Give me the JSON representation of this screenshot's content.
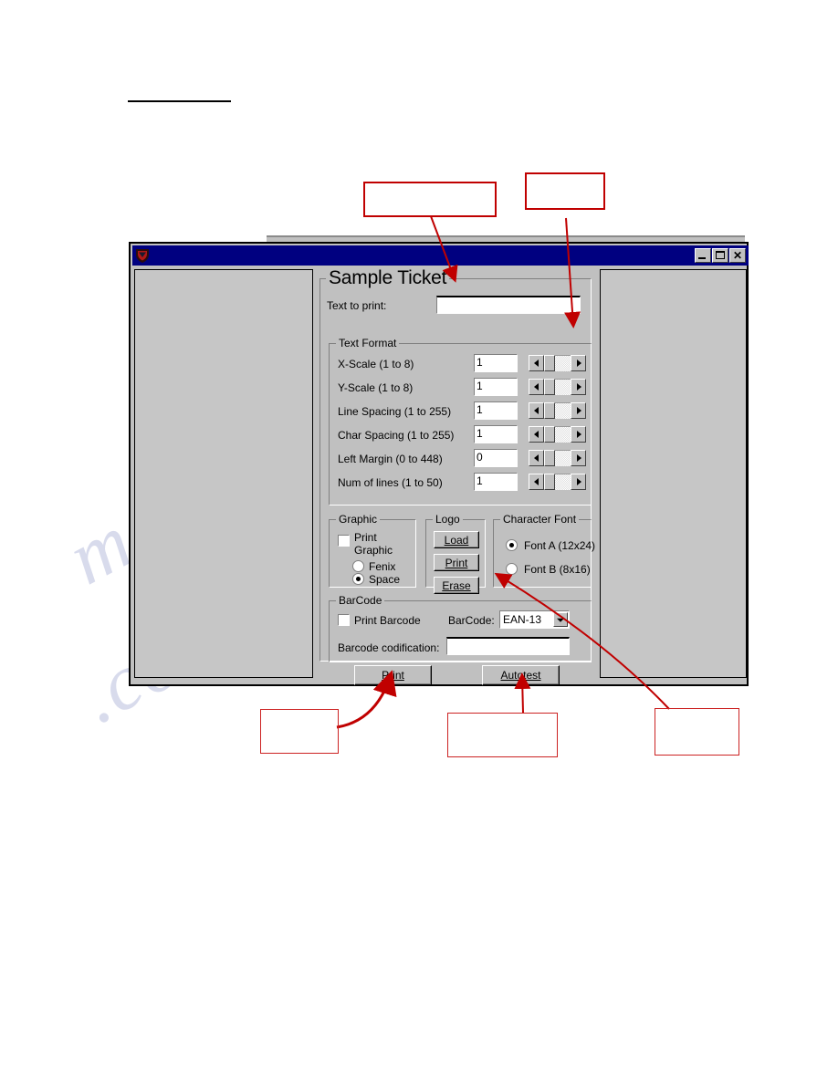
{
  "page": {
    "heading_rule": "",
    "watermark_line1": "manualslib",
    "watermark_line2": ".com"
  },
  "window": {
    "title": "",
    "icon": "app-shield-icon",
    "controls": {
      "minimize": "minimize-icon",
      "maximize": "maximize-icon",
      "close": "✕"
    }
  },
  "dialog": {
    "group_title": "Sample Ticket",
    "text_to_print": {
      "label": "Text to print:",
      "value": "",
      "placeholder": ""
    },
    "text_format": {
      "legend": "Text Format",
      "rows": [
        {
          "label": "X-Scale (1 to 8)",
          "value": "1"
        },
        {
          "label": "Y-Scale (1 to 8)",
          "value": "1"
        },
        {
          "label": "Line Spacing (1 to 255)",
          "value": "1"
        },
        {
          "label": "Char Spacing (1 to 255)",
          "value": "1"
        },
        {
          "label": "Left Margin (0 to 448)",
          "value": "0"
        },
        {
          "label": "Num of lines (1 to 50)",
          "value": "1"
        }
      ]
    },
    "graphic": {
      "legend": "Graphic",
      "print_graphic_label": "Print Graphic",
      "print_graphic_checked": false,
      "options": [
        {
          "label": "Fenix",
          "selected": false
        },
        {
          "label": "Space",
          "selected": true
        }
      ]
    },
    "logo": {
      "legend": "Logo",
      "buttons": [
        {
          "label": "Load",
          "mnemonic": "L"
        },
        {
          "label": "Print",
          "mnemonic": "P"
        },
        {
          "label": "Erase",
          "mnemonic": "E"
        }
      ]
    },
    "character_font": {
      "legend": "Character Font",
      "options": [
        {
          "label": "Font A (12x24)",
          "selected": true
        },
        {
          "label": "Font B (8x16)",
          "selected": false
        }
      ]
    },
    "barcode": {
      "legend": "BarCode",
      "print_barcode_label": "Print Barcode",
      "print_barcode_checked": false,
      "select_label": "BarCode:",
      "selected_type": "EAN-13",
      "codification_label": "Barcode codification:",
      "codification_value": ""
    },
    "actions": [
      {
        "label": "Print",
        "mnemonic": "P"
      },
      {
        "label": "Autotest",
        "mnemonic": "A"
      }
    ]
  },
  "annotations": {
    "accent_color": "#c00000",
    "callouts": [
      {
        "name": "callout-text-to-print",
        "text": ""
      },
      {
        "name": "callout-scroll-control",
        "text": ""
      },
      {
        "name": "callout-print-button",
        "text": ""
      },
      {
        "name": "callout-autotest-button",
        "text": ""
      },
      {
        "name": "callout-logo-erase",
        "text": ""
      }
    ]
  }
}
